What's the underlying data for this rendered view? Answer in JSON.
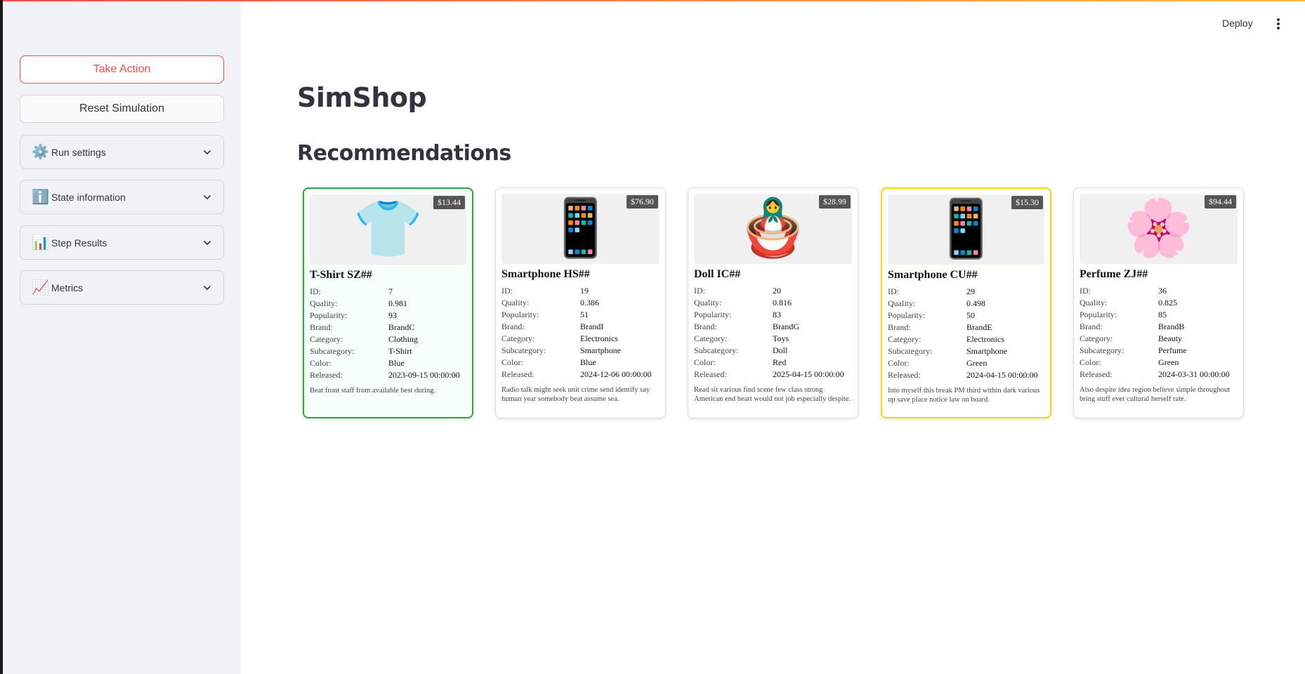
{
  "sidebar": {
    "take_action": "Take Action",
    "reset": "Reset Simulation",
    "expanders": [
      {
        "icon": "gear-emoji",
        "emoji": "⚙️",
        "label": "Run settings"
      },
      {
        "icon": "info-emoji",
        "emoji": "ℹ️",
        "label": "State information"
      },
      {
        "icon": "bar-chart-emoji",
        "emoji": "📊",
        "label": "Step Results"
      },
      {
        "icon": "line-chart-emoji",
        "emoji": "📈",
        "label": "Metrics"
      }
    ]
  },
  "header": {
    "deploy": "Deploy"
  },
  "main": {
    "title": "SimShop",
    "subtitle": "Recommendations"
  },
  "labels": {
    "id": "ID:",
    "quality": "Quality:",
    "popularity": "Popularity:",
    "brand": "Brand:",
    "category": "Category:",
    "subcategory": "Subcategory:",
    "color": "Color:",
    "released": "Released:"
  },
  "cards": [
    {
      "highlight": "green",
      "emoji": "👕",
      "icon": "tshirt-icon",
      "price": "$13.44",
      "name": "T-Shirt SZ##",
      "id": "7",
      "quality": "0.981",
      "popularity": "93",
      "brand": "BrandC",
      "category": "Clothing",
      "subcategory": "T-Shirt",
      "color": "Blue",
      "released": "2023-09-15 00:00:00",
      "description": "Beat front staff from available best during."
    },
    {
      "highlight": "none",
      "emoji": "📱",
      "icon": "smartphone-icon",
      "price": "$76.90",
      "name": "Smartphone HS##",
      "id": "19",
      "quality": "0.386",
      "popularity": "51",
      "brand": "BrandI",
      "category": "Electronics",
      "subcategory": "Smartphone",
      "color": "Blue",
      "released": "2024-12-06 00:00:00",
      "description": "Radio talk might seek unit crime send identify say human year somebody beat assume sea."
    },
    {
      "highlight": "none",
      "emoji": "🪆",
      "icon": "doll-icon",
      "price": "$28.99",
      "name": "Doll IC##",
      "id": "20",
      "quality": "0.816",
      "popularity": "83",
      "brand": "BrandG",
      "category": "Toys",
      "subcategory": "Doll",
      "color": "Red",
      "released": "2025-04-15 00:00:00",
      "description": "Read sit various find scene few class strong American end heart would not job especially despite."
    },
    {
      "highlight": "yellow",
      "emoji": "📱",
      "icon": "smartphone-icon",
      "price": "$15.30",
      "name": "Smartphone CU##",
      "id": "29",
      "quality": "0.498",
      "popularity": "50",
      "brand": "BrandE",
      "category": "Electronics",
      "subcategory": "Smartphone",
      "color": "Green",
      "released": "2024-04-15 00:00:00",
      "description": "Into myself this break PM third within dark various up save place notice law on board."
    },
    {
      "highlight": "none",
      "emoji": "🌸",
      "icon": "flower-icon",
      "price": "$94.44",
      "name": "Perfume ZJ##",
      "id": "36",
      "quality": "0.825",
      "popularity": "85",
      "brand": "BrandB",
      "category": "Beauty",
      "subcategory": "Perfume",
      "color": "Green",
      "released": "2024-03-31 00:00:00",
      "description": "Also despite idea region believe simple throughout bring stuff ever cultural herself rate."
    }
  ]
}
